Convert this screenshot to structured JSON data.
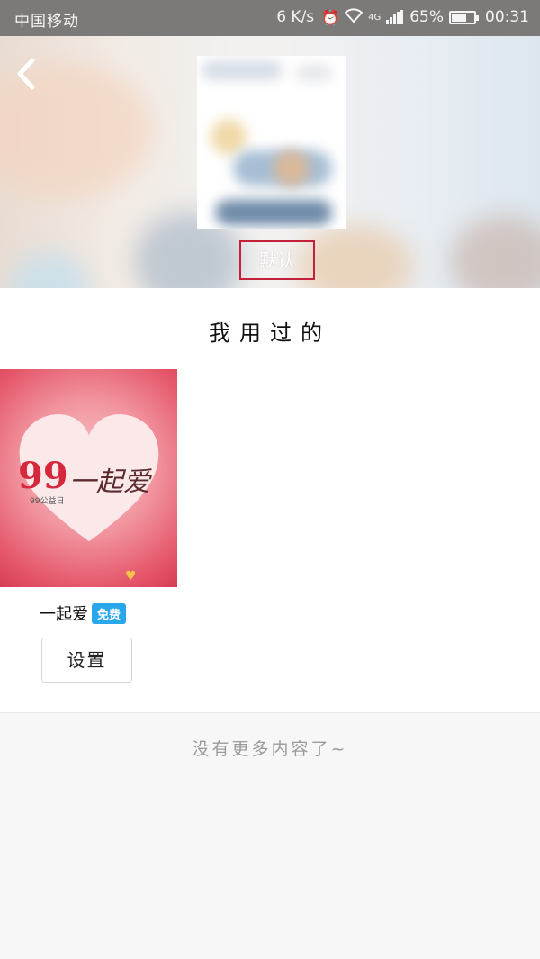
{
  "status_bar": {
    "carrier": "中国移动",
    "speed": "6 K/s",
    "network": "4G",
    "battery_pct": "65%",
    "time": "00:31",
    "battery_level": 0.65
  },
  "header": {
    "back_icon": "back-chevron-icon",
    "default_label": "默认"
  },
  "used_section": {
    "title": "我用过的",
    "items": [
      {
        "name": "一起爱",
        "badge": "免费",
        "badge_color": "#2aa6ea",
        "button_label": "设置",
        "image": {
          "logo": "99",
          "subtitle": "99公益日",
          "title": "一起爱"
        }
      }
    ]
  },
  "footer": {
    "text": "没有更多内容了~"
  }
}
